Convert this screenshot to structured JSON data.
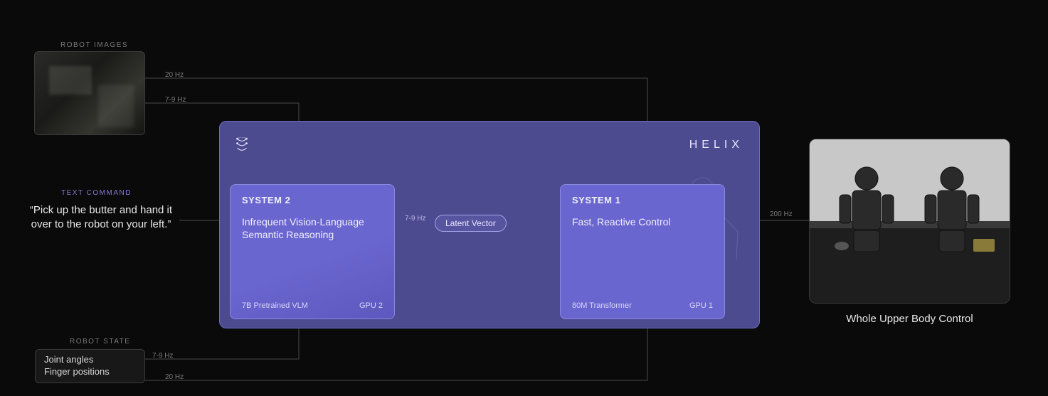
{
  "inputs": {
    "robot_images_label": "ROBOT IMAGES",
    "text_command_label": "TEXT COMMAND",
    "text_command": "“Pick up the butter and hand it over to the robot on your left.”",
    "robot_state_label": "ROBOT STATE",
    "robot_state_line1": "Joint angles",
    "robot_state_line2": "Finger positions"
  },
  "connectors": {
    "images_to_s1": "20 Hz",
    "images_to_s2": "7-9 Hz",
    "state_to_s2": "7-9 Hz",
    "state_to_s1": "20 Hz",
    "s2_to_s1": "7-9 Hz",
    "latent_label": "Latent Vector",
    "helix_to_output": "200 Hz"
  },
  "helix": {
    "brand": "HELIX",
    "system2": {
      "title": "SYSTEM 2",
      "desc": "Infrequent Vision-Language Semantic Reasoning",
      "model": "7B Pretrained VLM",
      "gpu": "GPU 2"
    },
    "system1": {
      "title": "SYSTEM 1",
      "desc": "Fast, Reactive Control",
      "model": "80M Transformer",
      "gpu": "GPU 1"
    }
  },
  "output": {
    "caption": "Whole Upper Body Control"
  }
}
